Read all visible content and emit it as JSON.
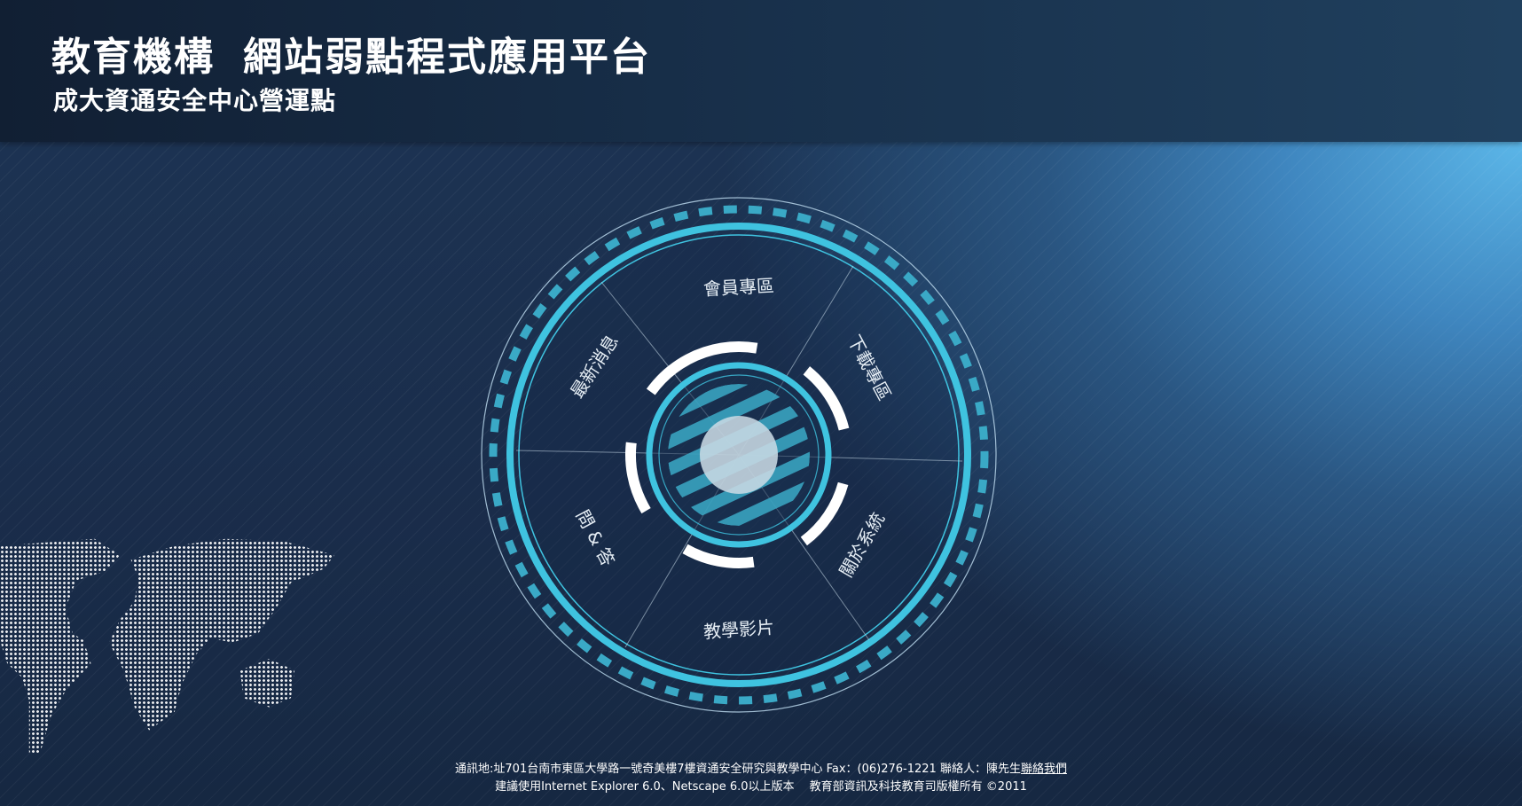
{
  "header": {
    "title_org": "教育機構",
    "title_main": "網站弱點程式應用平台",
    "subtitle": "成大資通安全中心營運點"
  },
  "menu": {
    "items": [
      {
        "label": "會員專區"
      },
      {
        "label": "下載專區"
      },
      {
        "label": "關於系統"
      },
      {
        "label": "教學影片"
      },
      {
        "label": "問 & 答"
      },
      {
        "label": "最新消息"
      }
    ]
  },
  "footer": {
    "address": "通訊地:址701台南市東區大學路一號奇美樓7樓資通安全研究與教學中心 Fax：(06)276-1221 聯絡人：陳先生",
    "contact_link": "聯絡我們",
    "notice": "建議使用Internet Explorer 6.0、Netscape 6.0以上版本　 教育部資訊及科技教育司版權所有 ©2011"
  },
  "colors": {
    "accent": "#3fc3e0",
    "ring_dark": "#2b9cc0",
    "header_bg": "#14253b",
    "text": "#ffffff"
  },
  "icons": {
    "world_map": "world-map-dots",
    "dial_center": "radar-hub"
  }
}
